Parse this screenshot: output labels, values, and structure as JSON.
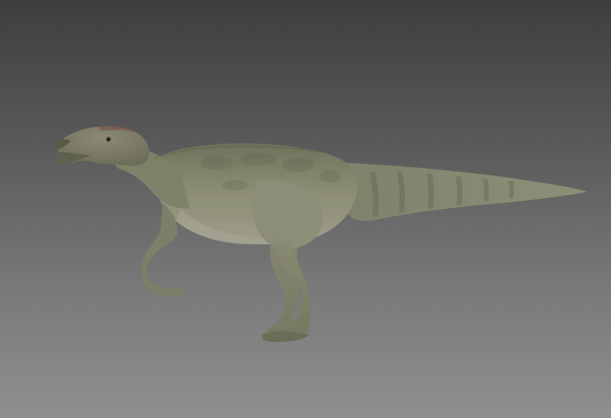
{
  "scene": {
    "colors": {
      "background_top": "#3e3e3e",
      "background_bottom": "#8f8f8f",
      "body_base": "#8a8c72",
      "body_dark": "#5f6250",
      "body_light": "#a7a58f",
      "belly": "#9c9a8a",
      "head_accent": "#7a5a4e"
    },
    "model": {
      "subject": "dinosaur-model",
      "pose": "walking",
      "facing": "left"
    }
  }
}
